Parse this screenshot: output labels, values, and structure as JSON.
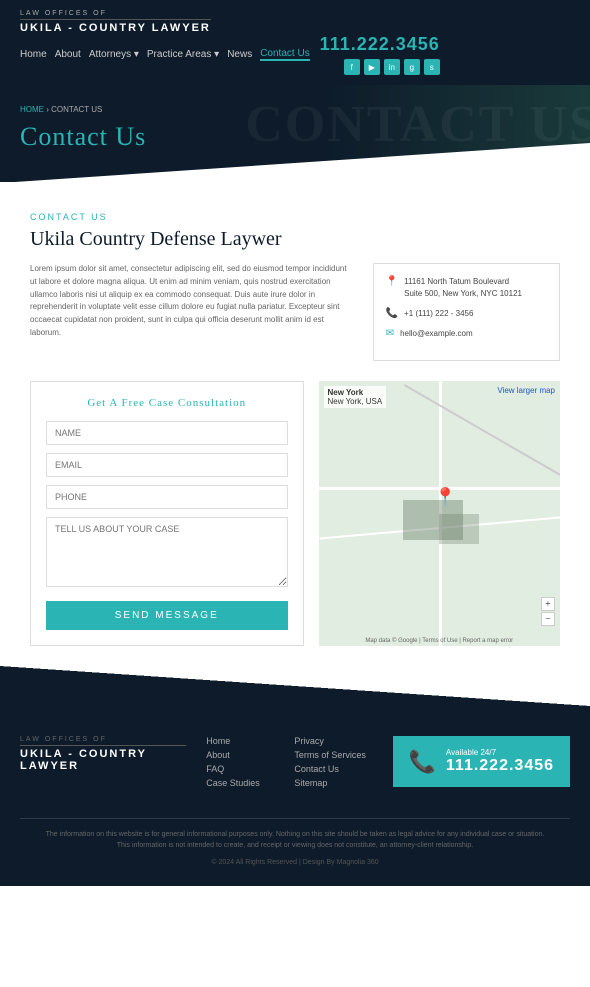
{
  "header": {
    "logo_top": "LAW OFFICES OF",
    "logo_name": "UKILA - COUNTRY LAWYER",
    "nav": [
      {
        "label": "Home",
        "active": false
      },
      {
        "label": "About",
        "active": false
      },
      {
        "label": "Attorneys",
        "active": false,
        "dropdown": true
      },
      {
        "label": "Practice Areas",
        "active": false,
        "dropdown": true
      },
      {
        "label": "News",
        "active": false
      },
      {
        "label": "Contact Us",
        "active": true
      }
    ],
    "phone": "111.222.3456",
    "social": [
      "f",
      "y",
      "in",
      "g",
      "s"
    ]
  },
  "breadcrumb": {
    "home": "HOME",
    "current": "CONTACT US"
  },
  "hero": {
    "title": "Contact Us",
    "bg_text": "CONTACT US"
  },
  "main": {
    "section_label": "CONTACT US",
    "section_title": "Ukila Country Defense Laywer",
    "description": "Lorem ipsum dolor sit amet, consectetur adipiscing elit, sed do eiusmod tempor incididunt ut labore et dolore magna aliqua. Ut enim ad minim veniam, quis nostrud exercitation ullamco laboris nisi ut aliquip ex ea commodo consequat. Duis aute irure dolor in reprehenderit in voluptate velit esse cillum dolore eu fugiat nulla pariatur. Excepteur sint occaecat cupidatat non proident, sunt in culpa qui officia deserunt mollit anim id est laborum.",
    "contact_box": {
      "address_icon": "📍",
      "address": "11161 North Tatum Boulevard\nSuite 500, New York, NYC 10121",
      "phone_icon": "📞",
      "phone": "+1 (111) 222 - 3456",
      "email_icon": "✉",
      "email": "hello@example.com"
    },
    "form": {
      "title": "Get A Free Case Consultation",
      "name_placeholder": "NAME",
      "email_placeholder": "EMAIL",
      "phone_placeholder": "PHONE",
      "message_placeholder": "TELL US ABOUT YOUR CASE",
      "submit_label": "SEND MESSAGE"
    },
    "map": {
      "label": "New York",
      "sublabel": "New York, USA",
      "larger_map": "View larger map"
    }
  },
  "footer": {
    "logo_top": "LAW OFFICES OF",
    "logo_name": "UKILA - COUNTRY LAWYER",
    "links": [
      {
        "label": "Home"
      },
      {
        "label": "Privacy"
      },
      {
        "label": "About"
      },
      {
        "label": "Terms of Services"
      },
      {
        "label": "FAQ"
      },
      {
        "label": "Contact Us"
      },
      {
        "label": "Case Studies"
      },
      {
        "label": "Sitemap"
      }
    ],
    "phone_label": "Available 24/7",
    "phone_number": "111.222.3456",
    "disclaimer": "The information on this website is for general informational purposes only. Nothing on this site should be taken as legal advice for any individual case or situation. This information is not intended to create, and receipt or viewing does not constitute, an attorney-client relationship.",
    "copyright": "© 2024 All Rights Reserved | Design By Magnolia 360"
  }
}
